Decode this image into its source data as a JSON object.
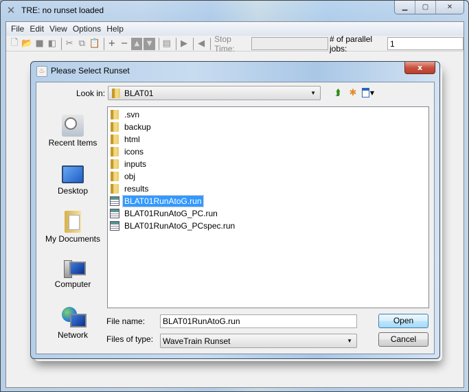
{
  "window": {
    "title": "TRE:  no runset loaded",
    "controls": {
      "minimize": "▁",
      "maximize": "▢",
      "close": "✕"
    }
  },
  "menubar": {
    "items": [
      "File",
      "Edit",
      "View",
      "Options",
      "Help"
    ]
  },
  "toolbar": {
    "icons": [
      "new-icon",
      "open-icon",
      "save-icon",
      "save-all-icon",
      "cut-icon",
      "copy-icon",
      "paste-icon",
      "add-icon",
      "remove-icon",
      "move-up-icon",
      "move-down-icon",
      "tree-icon",
      "run-icon",
      "stop-icon"
    ],
    "stop_time_label": "Stop Time:",
    "stop_time_value": "",
    "parallel_jobs_label": "# of parallel jobs:",
    "parallel_jobs_value": "1"
  },
  "dialog": {
    "title": "Please Select Runset",
    "close_label": "x",
    "look_in_label": "Look in:",
    "look_in_value": "BLAT01",
    "places": [
      {
        "label": "Recent Items",
        "icon": "recent-items-icon"
      },
      {
        "label": "Desktop",
        "icon": "desktop-icon"
      },
      {
        "label": "My Documents",
        "icon": "my-documents-icon"
      },
      {
        "label": "Computer",
        "icon": "computer-icon"
      },
      {
        "label": "Network",
        "icon": "network-icon"
      }
    ],
    "files": [
      {
        "name": ".svn",
        "type": "folder"
      },
      {
        "name": "backup",
        "type": "folder"
      },
      {
        "name": "html",
        "type": "folder"
      },
      {
        "name": "icons",
        "type": "folder"
      },
      {
        "name": "inputs",
        "type": "folder"
      },
      {
        "name": "obj",
        "type": "folder"
      },
      {
        "name": "results",
        "type": "folder"
      },
      {
        "name": "BLAT01RunAtoG.run",
        "type": "file",
        "selected": true
      },
      {
        "name": "BLAT01RunAtoG_PC.run",
        "type": "file"
      },
      {
        "name": "BLAT01RunAtoG_PCspec.run",
        "type": "file"
      }
    ],
    "file_name_label": "File name:",
    "file_name_value": "BLAT01RunAtoG.run",
    "files_of_type_label": "Files of type:",
    "files_of_type_value": "WaveTrain Runset",
    "open_label": "Open",
    "cancel_label": "Cancel"
  }
}
